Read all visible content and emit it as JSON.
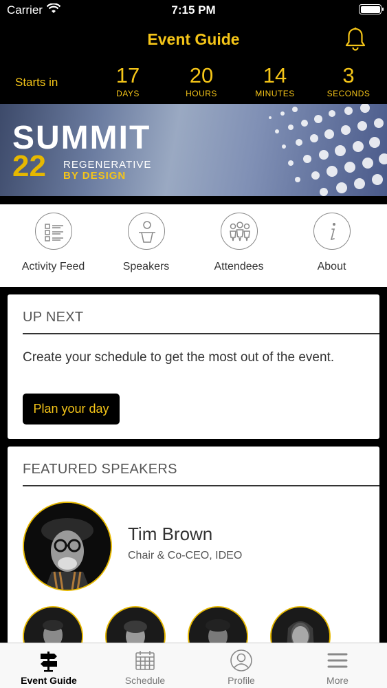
{
  "status_bar": {
    "carrier": "Carrier",
    "time": "7:15 PM"
  },
  "nav": {
    "title": "Event Guide",
    "bell_icon": "bell-icon"
  },
  "countdown": {
    "starts_label": "Starts in",
    "units": [
      {
        "value": "17",
        "label": "DAYS"
      },
      {
        "value": "20",
        "label": "HOURS"
      },
      {
        "value": "14",
        "label": "MINUTES"
      },
      {
        "value": "3",
        "label": "SECONDS"
      }
    ]
  },
  "banner": {
    "word": "SUMMIT",
    "number": "22",
    "line1": "REGENERATIVE",
    "line2": "BY DESIGN"
  },
  "quick_nav": [
    {
      "label": "Activity Feed",
      "icon": "activity-list-icon"
    },
    {
      "label": "Speakers",
      "icon": "speaker-podium-icon"
    },
    {
      "label": "Attendees",
      "icon": "attendees-group-icon"
    },
    {
      "label": "About",
      "icon": "info-icon"
    }
  ],
  "up_next": {
    "title": "UP NEXT",
    "message": "Create your schedule to get the most out of the event.",
    "button": "Plan your day"
  },
  "featured_speakers": {
    "title": "FEATURED SPEAKERS",
    "main": {
      "name": "Tim Brown",
      "role": "Chair & Co-CEO, IDEO"
    }
  },
  "tabbar": [
    {
      "label": "Event Guide",
      "icon": "signpost-icon",
      "active": true
    },
    {
      "label": "Schedule",
      "icon": "calendar-icon",
      "active": false
    },
    {
      "label": "Profile",
      "icon": "profile-icon",
      "active": false
    },
    {
      "label": "More",
      "icon": "menu-icon",
      "active": false
    }
  ],
  "colors": {
    "accent": "#f5c518",
    "background": "#000000",
    "card": "#ffffff"
  }
}
